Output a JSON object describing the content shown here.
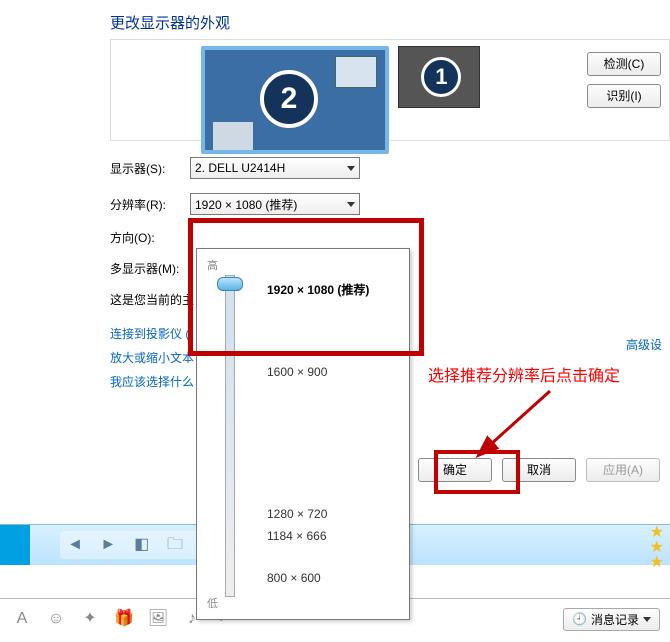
{
  "heading": "更改显示器的外观",
  "monitors": {
    "primary": "2",
    "secondary": "1"
  },
  "side_buttons": {
    "detect": "检测(C)",
    "identify": "识别(I)"
  },
  "labels": {
    "display": "显示器(S):",
    "resolution": "分辨率(R):",
    "orientation": "方向(O):",
    "multi": "多显示器(M):",
    "current": "这是您当前的主"
  },
  "display_value": "2. DELL U2414H",
  "resolution_value": "1920 × 1080 (推荐)",
  "slider": {
    "high": "高",
    "low": "低"
  },
  "options": {
    "o0": "1920 × 1080 (推荐)",
    "o1": "1600 × 900",
    "o2": "1280 × 720",
    "o3": "1184 × 666",
    "o4": "800 × 600"
  },
  "annotation": "选择推荐分辨率后点击确定",
  "links": {
    "l0": "连接到投影仪 (",
    "l1": "放大或缩小文本",
    "l2": "我应该选择什么"
  },
  "advanced": "高级设",
  "actions": {
    "ok": "确定",
    "cancel": "取消",
    "apply": "应用(A)"
  },
  "bottom": {
    "msg": "消息记录"
  }
}
